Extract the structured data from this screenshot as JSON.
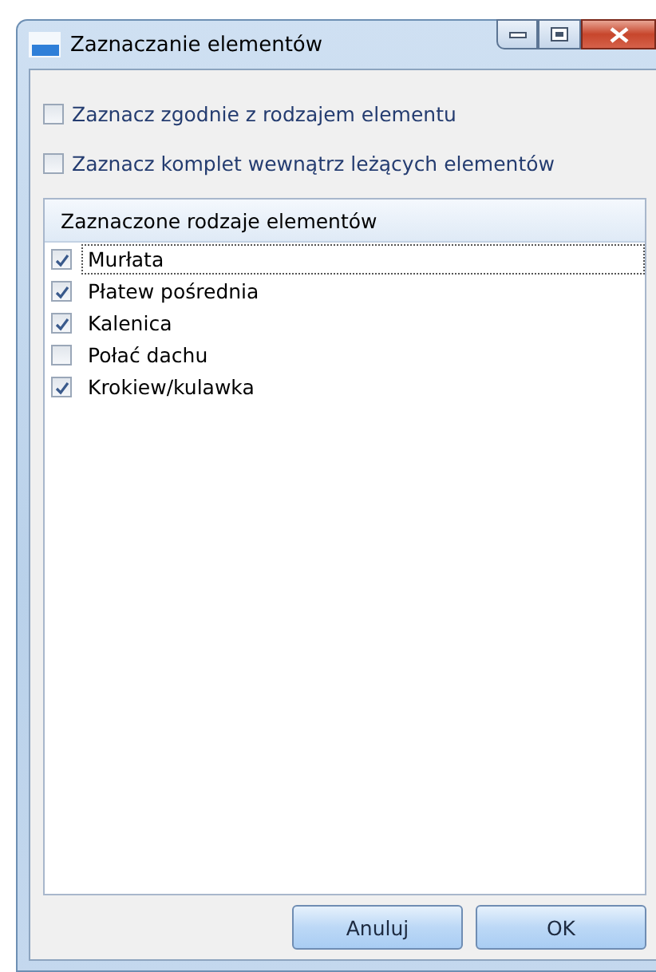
{
  "window": {
    "title": "Zaznaczanie elementów"
  },
  "options": [
    {
      "label": "Zaznacz zgodnie z rodzajem elementu",
      "checked": false
    },
    {
      "label": "Zaznacz komplet wewnątrz leżących elementów",
      "checked": false
    }
  ],
  "list": {
    "header": "Zaznaczone rodzaje elementów",
    "items": [
      {
        "label": "Murłata",
        "checked": true,
        "focused": true
      },
      {
        "label": "Płatew pośrednia",
        "checked": true,
        "focused": false
      },
      {
        "label": "Kalenica",
        "checked": true,
        "focused": false
      },
      {
        "label": "Połać dachu",
        "checked": false,
        "focused": false
      },
      {
        "label": "Krokiew/kulawka",
        "checked": true,
        "focused": false
      }
    ]
  },
  "buttons": [
    "Anuluj",
    "OK"
  ]
}
